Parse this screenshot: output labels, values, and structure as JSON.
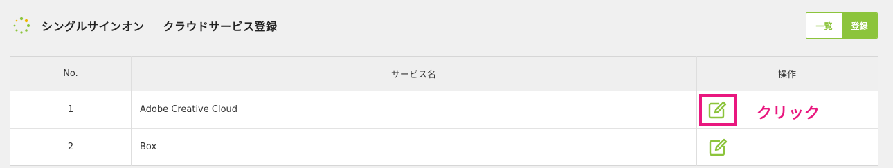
{
  "header": {
    "app_title": "シングルサインオン",
    "page_title": "クラウドサービス登録",
    "buttons": {
      "list": "一覧",
      "register": "登録"
    }
  },
  "table": {
    "columns": [
      "No.",
      "サービス名",
      "操作"
    ],
    "rows": [
      {
        "no": "1",
        "name": "Adobe Creative Cloud"
      },
      {
        "no": "2",
        "name": "Box"
      }
    ]
  },
  "annotation": {
    "label": "クリック"
  },
  "colors": {
    "accent": "#8cc43c",
    "highlight": "#e9177f"
  },
  "icons": {
    "logo": "loading-dots-icon",
    "edit": "edit-pencil-icon"
  }
}
